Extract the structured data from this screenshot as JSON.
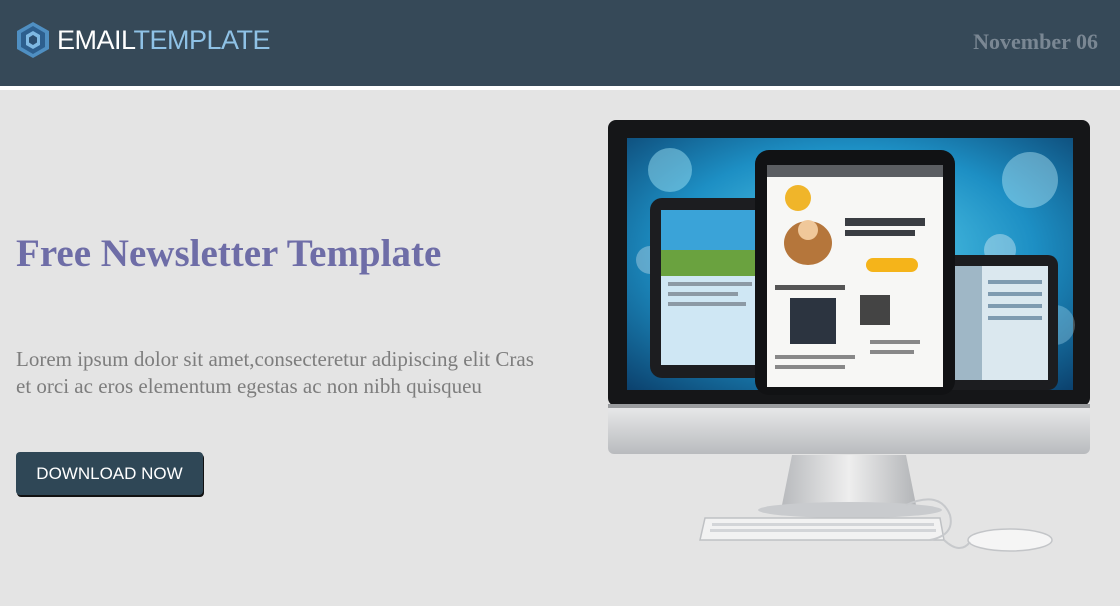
{
  "header": {
    "logo_icon": "hexagon-logo-icon",
    "logo_part1": "EMAIL",
    "logo_part2": "TEMPLATE",
    "date": "November 06"
  },
  "hero": {
    "title": "Free Newsletter Template",
    "description": "Lorem ipsum dolor sit amet,consecteretur adipiscing elit Cras et orci ac eros elementum egestas ac non nibh quisqueu",
    "button_label": "DOWNLOAD NOW",
    "image": "desktop-monitor-with-tablets-illustration"
  },
  "colors": {
    "header_bg": "#364958",
    "title": "#6e6da7",
    "button_bg": "#2f4756",
    "body_bg": "#e4e4e4"
  }
}
